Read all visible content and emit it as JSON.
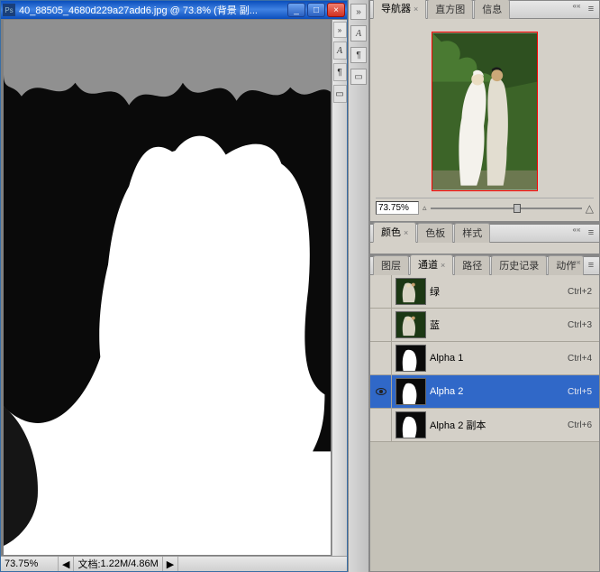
{
  "document": {
    "title": "40_88505_4680d229a27add6.jpg @ 73.8% (背景 副...",
    "zoom_field": "73.75%",
    "status_label": "文档:",
    "status_value": "1.22M/4.86M"
  },
  "navigator": {
    "tabs": [
      {
        "label": "导航器",
        "active": true,
        "closable": true
      },
      {
        "label": "直方图",
        "active": false,
        "closable": false
      },
      {
        "label": "信息",
        "active": false,
        "closable": false
      }
    ],
    "zoom_value": "73.75%"
  },
  "color_panel": {
    "tabs": [
      {
        "label": "颜色",
        "active": true,
        "closable": true
      },
      {
        "label": "色板",
        "active": false,
        "closable": false
      },
      {
        "label": "样式",
        "active": false,
        "closable": false
      }
    ]
  },
  "channels_panel": {
    "tabs": [
      {
        "label": "图层",
        "active": false,
        "closable": false
      },
      {
        "label": "通道",
        "active": true,
        "closable": true
      },
      {
        "label": "路径",
        "active": false,
        "closable": false
      },
      {
        "label": "历史记录",
        "active": false,
        "closable": false
      },
      {
        "label": "动作",
        "active": false,
        "closable": false
      }
    ],
    "channels": [
      {
        "name": "绿",
        "shortcut": "Ctrl+2",
        "visible": false,
        "selected": false,
        "type": "color"
      },
      {
        "name": "蓝",
        "shortcut": "Ctrl+3",
        "visible": false,
        "selected": false,
        "type": "color"
      },
      {
        "name": "Alpha 1",
        "shortcut": "Ctrl+4",
        "visible": false,
        "selected": false,
        "type": "alpha"
      },
      {
        "name": "Alpha 2",
        "shortcut": "Ctrl+5",
        "visible": true,
        "selected": true,
        "type": "alpha"
      },
      {
        "name": "Alpha 2 副本",
        "shortcut": "Ctrl+6",
        "visible": false,
        "selected": false,
        "type": "alpha"
      }
    ]
  }
}
